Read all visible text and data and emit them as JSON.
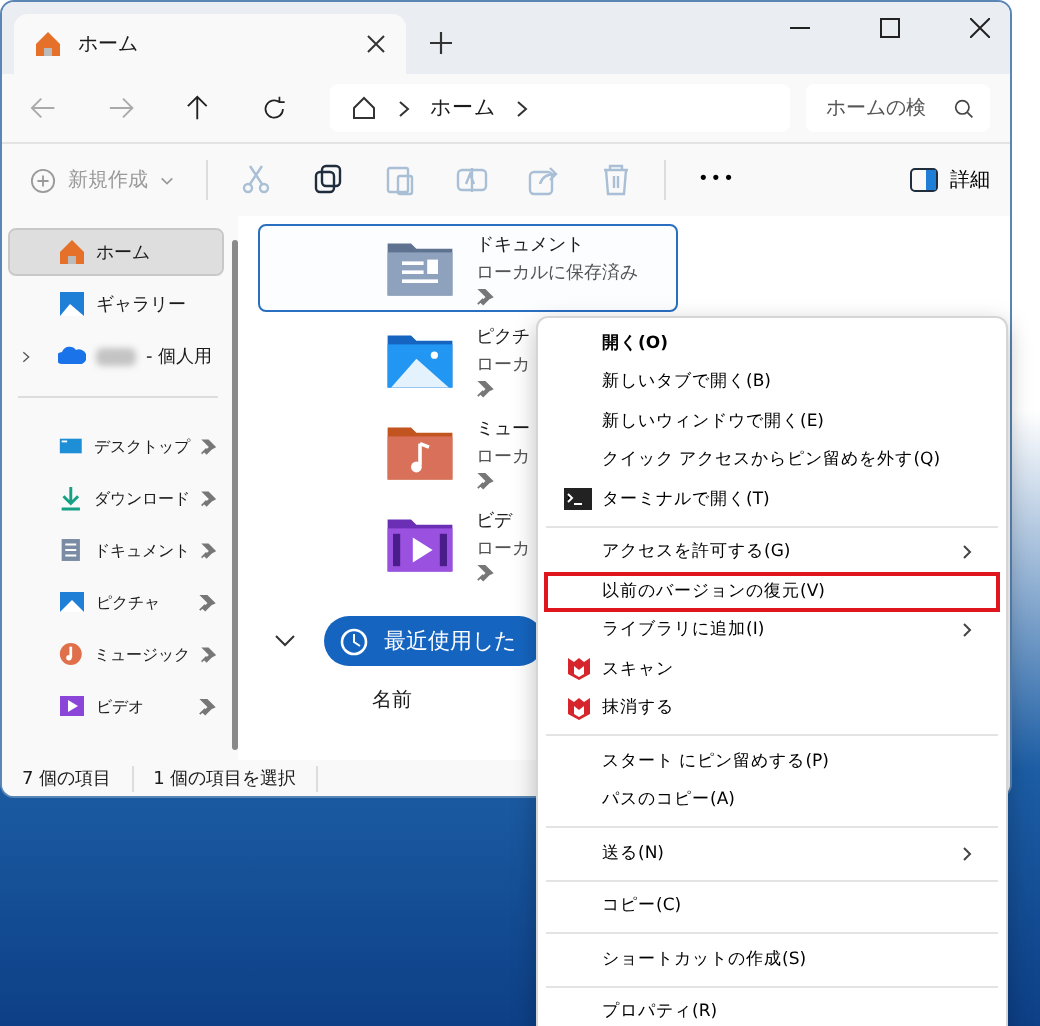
{
  "window": {
    "tab_title": "ホーム"
  },
  "address": {
    "segments": [
      "ホーム"
    ],
    "search_placeholder": "ホームの検"
  },
  "toolbar": {
    "new_label": "新規作成",
    "new_disabled": true,
    "actions": [
      {
        "kind": "cut",
        "disabled": true
      },
      {
        "kind": "copy",
        "disabled": false
      },
      {
        "kind": "paste",
        "disabled": true
      },
      {
        "kind": "rename",
        "disabled": true
      },
      {
        "kind": "share",
        "disabled": true
      },
      {
        "kind": "delete",
        "disabled": true
      }
    ],
    "more": "•••",
    "details_label": "詳細"
  },
  "sidebar": {
    "top": [
      {
        "label": "ホーム",
        "kind": "home",
        "selected": true
      },
      {
        "label": "ギャラリー",
        "kind": "gallery",
        "selected": false
      },
      {
        "label": "- 個人用",
        "kind": "cloud",
        "selected": false,
        "expanded": false,
        "redacted": true
      }
    ],
    "pinned": [
      {
        "label": "デスクトップ",
        "kind": "desktop",
        "selected": false
      },
      {
        "label": "ダウンロード",
        "kind": "download",
        "selected": false
      },
      {
        "label": "ドキュメント",
        "kind": "documents",
        "selected": false
      },
      {
        "label": "ピクチャ",
        "kind": "pictures",
        "selected": false
      },
      {
        "label": "ミュージック",
        "kind": "music",
        "selected": false
      },
      {
        "label": "ビデオ",
        "kind": "video",
        "selected": false
      }
    ]
  },
  "files": [
    {
      "name": "ドキュメント",
      "status": "ローカルに保存済み",
      "kind": "documents",
      "selected": true
    },
    {
      "name": "ピクチ",
      "status": "ローカ",
      "kind": "pictures",
      "selected": false
    },
    {
      "name": "ミュー",
      "status": "ローカ",
      "kind": "music",
      "selected": false
    },
    {
      "name": "ビデ",
      "status": "ローカ",
      "kind": "video",
      "selected": false
    }
  ],
  "recent": {
    "label": "最近使用した"
  },
  "column_header": "名前",
  "status_bar": [
    "7 個の項目",
    "1 個の項目を選択"
  ],
  "context_menu": [
    {
      "kind": "item",
      "label": "開く(O)",
      "default": true,
      "submenu": false,
      "highlighted": false
    },
    {
      "kind": "item",
      "label": "新しいタブで開く(B)",
      "default": false,
      "submenu": false,
      "highlighted": false
    },
    {
      "kind": "item",
      "label": "新しいウィンドウで開く(E)",
      "default": false,
      "submenu": false,
      "highlighted": false
    },
    {
      "kind": "item",
      "label": "クイック アクセスからピン留めを外す(Q)",
      "default": false,
      "submenu": false,
      "highlighted": false
    },
    {
      "kind": "terminal",
      "label": "ターミナルで開く(T)",
      "default": false,
      "submenu": false,
      "highlighted": false
    },
    {
      "kind": "separator"
    },
    {
      "kind": "item",
      "label": "アクセスを許可する(G)",
      "default": false,
      "submenu": true,
      "highlighted": false
    },
    {
      "kind": "item",
      "label": "以前のバージョンの復元(V)",
      "default": false,
      "submenu": false,
      "highlighted": true
    },
    {
      "kind": "item",
      "label": "ライブラリに追加(I)",
      "default": false,
      "submenu": true,
      "highlighted": false
    },
    {
      "kind": "shield",
      "label": "スキャン",
      "default": false,
      "submenu": false,
      "highlighted": false
    },
    {
      "kind": "shield",
      "label": "抹消する",
      "default": false,
      "submenu": false,
      "highlighted": false
    },
    {
      "kind": "separator"
    },
    {
      "kind": "item",
      "label": "スタート にピン留めする(P)",
      "default": false,
      "submenu": false,
      "highlighted": false
    },
    {
      "kind": "item",
      "label": "パスのコピー(A)",
      "default": false,
      "submenu": false,
      "highlighted": false
    },
    {
      "kind": "separator"
    },
    {
      "kind": "item",
      "label": "送る(N)",
      "default": false,
      "submenu": true,
      "highlighted": false
    },
    {
      "kind": "separator"
    },
    {
      "kind": "item",
      "label": "コピー(C)",
      "default": false,
      "submenu": false,
      "highlighted": false
    },
    {
      "kind": "separator"
    },
    {
      "kind": "item",
      "label": "ショートカットの作成(S)",
      "default": false,
      "submenu": false,
      "highlighted": false
    },
    {
      "kind": "separator"
    },
    {
      "kind": "item",
      "label": "プロパティ(R)",
      "default": false,
      "submenu": false,
      "highlighted": false
    }
  ]
}
